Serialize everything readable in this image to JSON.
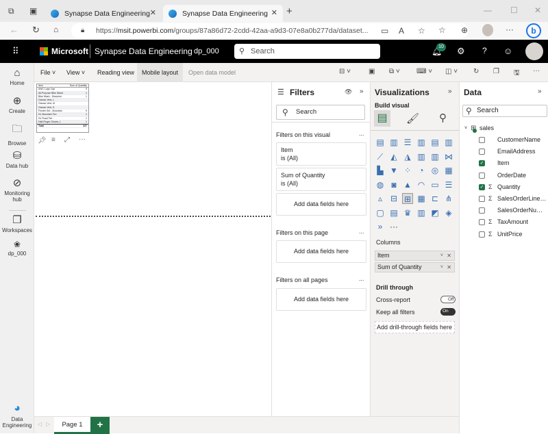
{
  "browser": {
    "tabs": [
      {
        "title": "Synapse Data Engineering",
        "active": false
      },
      {
        "title": "Synapse Data Engineering",
        "active": true
      }
    ],
    "url_prefix": "https://",
    "url_host": "msit.powerbi.com",
    "url_path": "/groups/87a86d72-2cdd-42aa-a9d3-07e8a0b277da/dataset...",
    "new_tab_label": "+",
    "window_controls": {
      "minimize": "—",
      "maximize": "☐",
      "close": "✕"
    }
  },
  "app_header": {
    "brand": "Microsoft",
    "product": "Synapse Data Engineering",
    "workspace": "dp_000",
    "search_placeholder": "Search",
    "notification_count": "10"
  },
  "left_nav": {
    "items": [
      {
        "label": "Home",
        "icon": "home-icon"
      },
      {
        "label": "Create",
        "icon": "plus-circle-icon"
      },
      {
        "label": "Browse",
        "icon": "folder-icon"
      },
      {
        "label": "Data hub",
        "icon": "data-hub-icon"
      },
      {
        "label": "Monitoring hub",
        "icon": "monitoring-icon"
      },
      {
        "label": "Workspaces",
        "icon": "workspaces-icon"
      },
      {
        "label": "dp_000",
        "icon": "workspace-avatar-icon"
      }
    ],
    "bottom": {
      "label": "Data Engineering",
      "icon": "data-engineering-icon"
    }
  },
  "ribbon": {
    "file": "File",
    "view": "View",
    "reading_view": "Reading view",
    "mobile_layout": "Mobile layout",
    "open_data_model": "Open data model",
    "more": "···"
  },
  "visual": {
    "headers": [
      "Item",
      "Sum of Quantity"
    ],
    "rows": [
      [
        "AWC Logo Cap",
        "9"
      ],
      [
        "All-Purpose Bike Stand",
        "1"
      ],
      [
        "Bike Wash - Dissolver",
        "1"
      ],
      [
        "Classic Vest, L",
        ""
      ],
      [
        "Classic Vest, M",
        ""
      ],
      [
        "Classic Vest, S",
        ""
      ],
      [
        "Fender Set - Mountain",
        "9"
      ],
      [
        "HL Mountain Tire",
        "1"
      ],
      [
        "HL Road Tire",
        "1"
      ],
      [
        "Half-Finger Gloves, L",
        "1"
      ]
    ],
    "total_label": "Total",
    "total_value": "327",
    "more": "···"
  },
  "filters": {
    "title": "Filters",
    "search_placeholder": "Search",
    "on_visual_label": "Filters on this visual",
    "visual_filters": [
      {
        "field": "Item",
        "state": "is (All)"
      },
      {
        "field": "Sum of Quantity",
        "state": "is (All)"
      }
    ],
    "add_fields": "Add data fields here",
    "on_page_label": "Filters on this page",
    "on_all_pages_label": "Filters on all pages",
    "more": "..."
  },
  "visualizations": {
    "title": "Visualizations",
    "build_visual": "Build visual",
    "columns_label": "Columns",
    "columns": [
      "Item",
      "Sum of Quantity"
    ],
    "drill_through": "Drill through",
    "cross_report": "Cross-report",
    "cross_report_state": "Off",
    "keep_all_filters": "Keep all filters",
    "keep_all_filters_state": "On",
    "add_drill": "Add drill-through fields here",
    "more": "···"
  },
  "data_pane": {
    "title": "Data",
    "search_placeholder": "Search",
    "table": "sales",
    "fields": [
      {
        "name": "CustomerName",
        "checked": false,
        "sigma": false
      },
      {
        "name": "EmailAddress",
        "checked": false,
        "sigma": false
      },
      {
        "name": "Item",
        "checked": true,
        "sigma": false
      },
      {
        "name": "OrderDate",
        "checked": false,
        "sigma": false
      },
      {
        "name": "Quantity",
        "checked": true,
        "sigma": true
      },
      {
        "name": "SalesOrderLineN...",
        "checked": false,
        "sigma": true
      },
      {
        "name": "SalesOrderNum...",
        "checked": false,
        "sigma": false
      },
      {
        "name": "TaxAmount",
        "checked": false,
        "sigma": true
      },
      {
        "name": "UnitPrice",
        "checked": false,
        "sigma": true
      }
    ]
  },
  "pages": {
    "tabs": [
      "Page 1"
    ],
    "add_label": "+"
  },
  "colors": {
    "accent": "#217346",
    "header_bg": "#000000",
    "pane_bg": "#f3f2f1"
  }
}
